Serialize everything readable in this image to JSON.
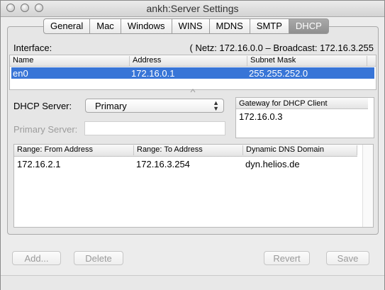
{
  "window": {
    "title": "ankh:Server Settings"
  },
  "tabs": [
    {
      "label": "General"
    },
    {
      "label": "Mac"
    },
    {
      "label": "Windows"
    },
    {
      "label": "WINS"
    },
    {
      "label": "MDNS"
    },
    {
      "label": "SMTP"
    },
    {
      "label": "DHCP",
      "active": true
    }
  ],
  "interface": {
    "label": "Interface:",
    "info": "( Netz: 172.16.0.0 – Broadcast: 172.16.3.255",
    "columns": [
      "Name",
      "Address",
      "Subnet Mask"
    ],
    "rows": [
      {
        "name": "en0",
        "address": "172.16.0.1",
        "subnet": "255.255.252.0"
      }
    ]
  },
  "dhcp": {
    "server_label": "DHCP Server:",
    "server_value": "Primary",
    "primary_server_label": "Primary Server:",
    "primary_server_value": ""
  },
  "gateway": {
    "header": "Gateway for DHCP Client",
    "value": "172.16.0.3"
  },
  "ranges": {
    "columns": [
      "Range:  From Address",
      "Range:  To Address",
      "Dynamic DNS Domain"
    ],
    "rows": [
      {
        "from": "172.16.2.1",
        "to": "172.16.3.254",
        "domain": "dyn.helios.de"
      }
    ]
  },
  "buttons": {
    "add": "Add...",
    "delete": "Delete",
    "revert": "Revert",
    "save": "Save"
  },
  "colors": {
    "selection": "#3875d7",
    "active_tab": "#9b9b9b"
  }
}
